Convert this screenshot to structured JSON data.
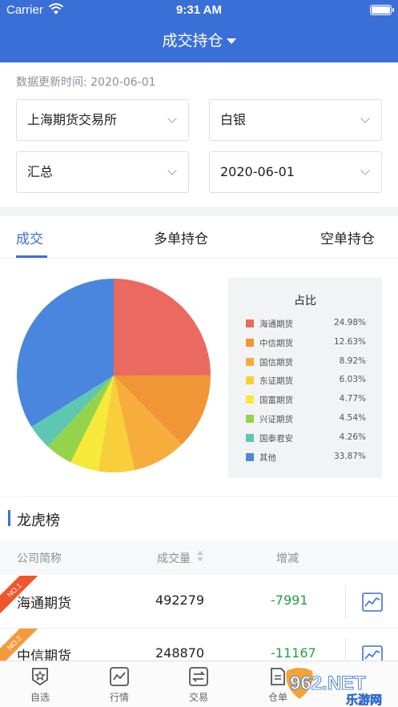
{
  "status_bar": {
    "carrier": "Carrier",
    "time": "9:31 AM"
  },
  "header": {
    "title": "成交持仓"
  },
  "filters": {
    "updated_text": "数据更新时间: 2020-06-01",
    "exchange": "上海期货交易所",
    "commodity": "白银",
    "scope": "汇总",
    "date": "2020-06-01"
  },
  "tabs": [
    {
      "label": "成交",
      "active": true
    },
    {
      "label": "多单持仓",
      "active": false
    },
    {
      "label": "空单持仓",
      "active": false
    }
  ],
  "chart_data": {
    "type": "pie",
    "title": "占比",
    "slices": [
      {
        "name": "海通期货",
        "label": "24.98%",
        "value": 24.98,
        "color": "#ea6a5f"
      },
      {
        "name": "中信期货",
        "label": "12.63%",
        "value": 12.63,
        "color": "#f09636"
      },
      {
        "name": "国信期货",
        "label": "8.92%",
        "value": 8.92,
        "color": "#f7ad3c"
      },
      {
        "name": "东证期货",
        "label": "6.03%",
        "value": 6.03,
        "color": "#f8cf3b"
      },
      {
        "name": "国富期货",
        "label": "4.77%",
        "value": 4.77,
        "color": "#f6e93a"
      },
      {
        "name": "兴证期货",
        "label": "4.54%",
        "value": 4.54,
        "color": "#95d34a"
      },
      {
        "name": "国泰君安",
        "label": "4.26%",
        "value": 4.26,
        "color": "#5ec7b2"
      },
      {
        "name": "其他",
        "label": "33.87%",
        "value": 33.87,
        "color": "#4a86dd"
      }
    ]
  },
  "leaderboard": {
    "title": "龙虎榜",
    "columns": {
      "name": "公司简称",
      "volume": "成交量",
      "change": "增减"
    },
    "rows": [
      {
        "rank": "NO.1",
        "rank_color": "#f2552c",
        "name": "海通期货",
        "volume": "492279",
        "change": "-7991"
      },
      {
        "rank": "NO.2",
        "rank_color": "#f59a3b",
        "name": "中信期货",
        "volume": "248870",
        "change": "-11167"
      }
    ]
  },
  "tabbar": [
    {
      "label": "自选",
      "icon": "star-icon"
    },
    {
      "label": "行情",
      "icon": "chart-icon"
    },
    {
      "label": "交易",
      "icon": "exchange-icon"
    },
    {
      "label": "仓单",
      "icon": "document-icon"
    }
  ],
  "watermark": {
    "text": "962.NET",
    "subtext": "乐游网"
  }
}
